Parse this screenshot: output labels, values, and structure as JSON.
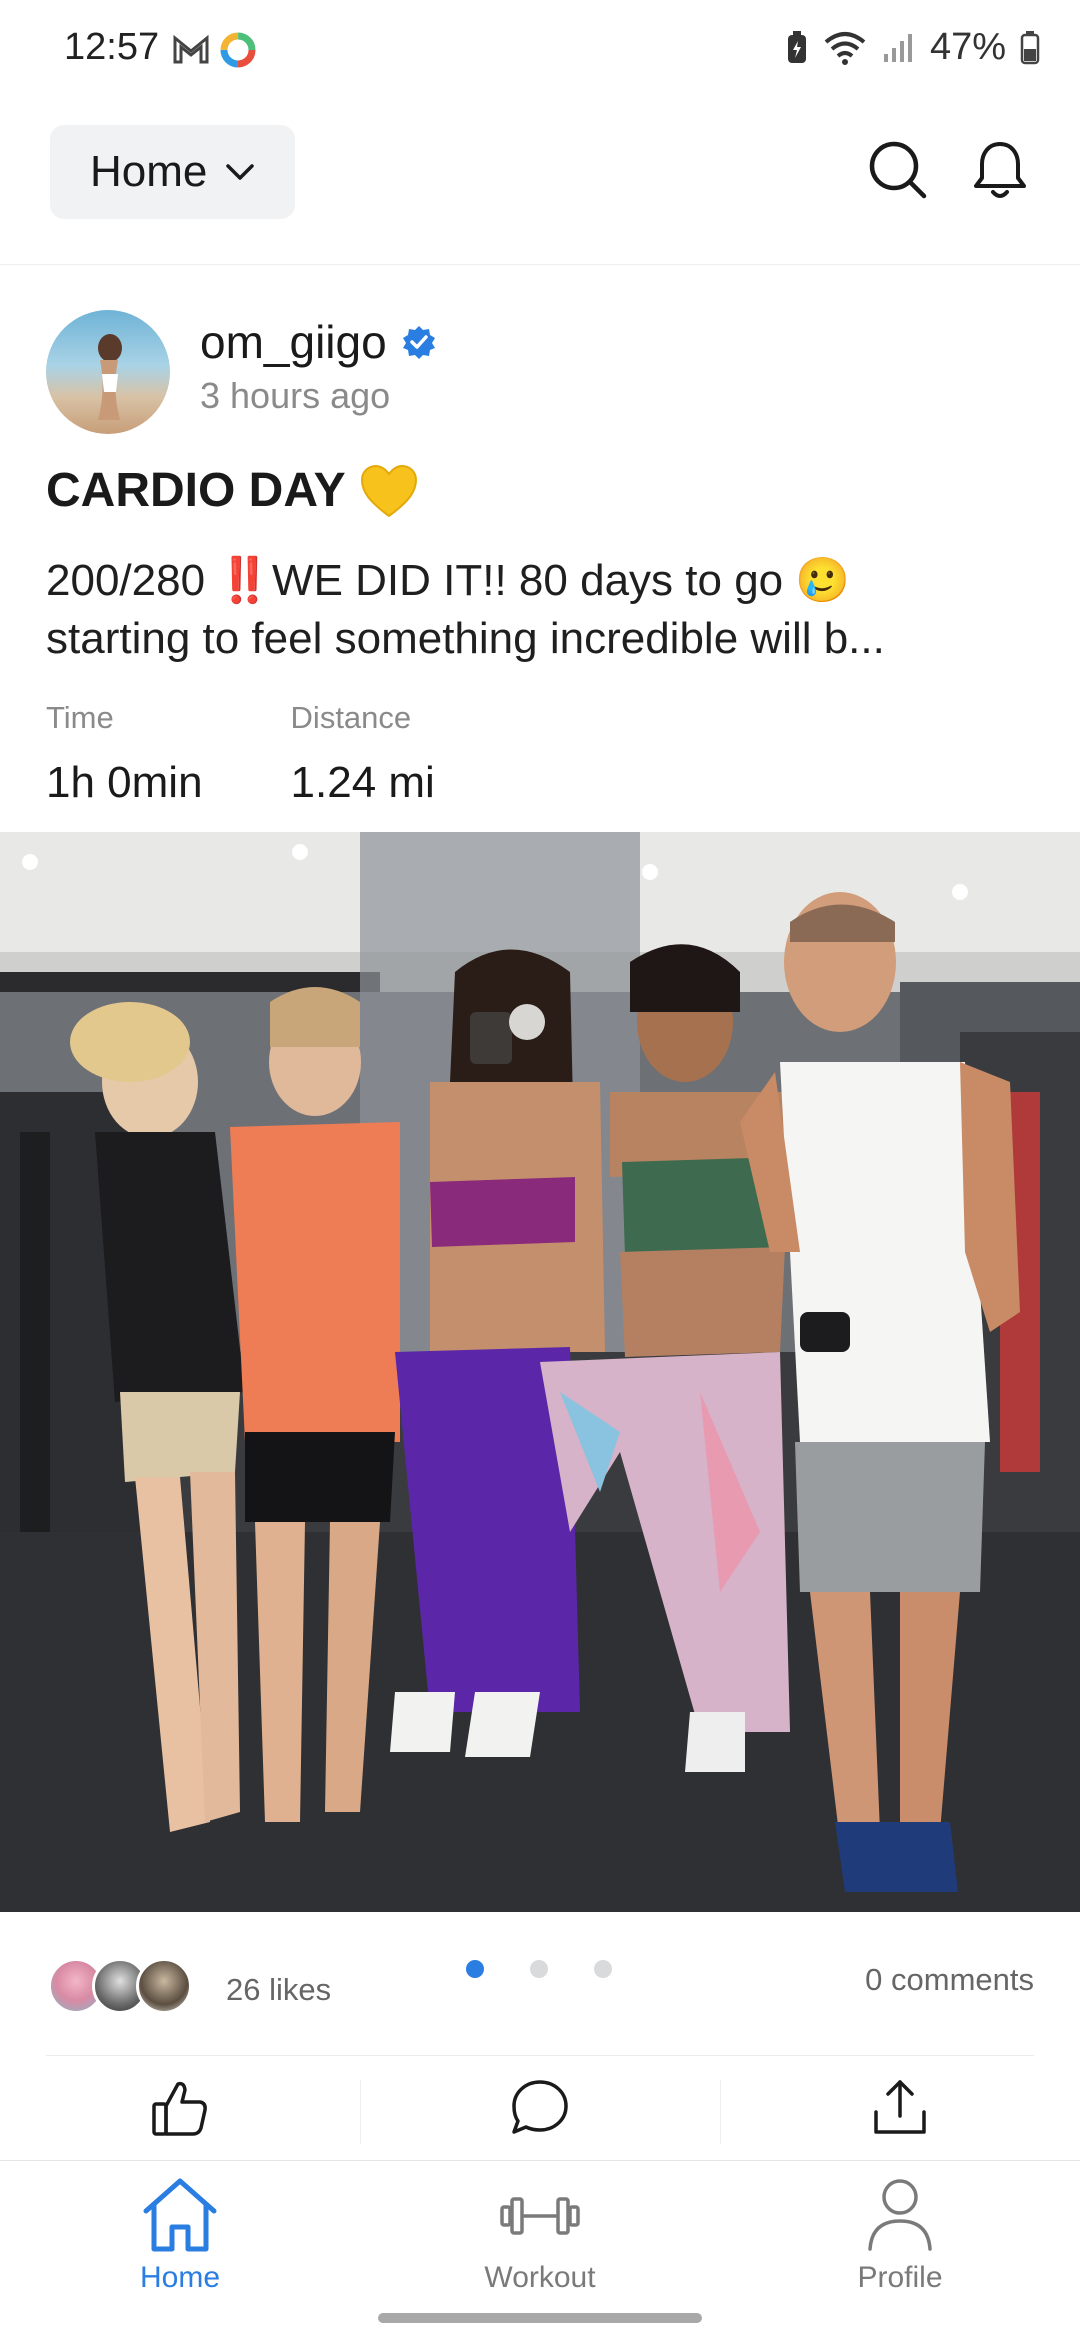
{
  "status_bar": {
    "time": "12:57",
    "battery": "47%"
  },
  "header": {
    "dropdown_label": "Home",
    "icons": [
      "search-icon",
      "bell-icon"
    ]
  },
  "post": {
    "username": "om_giigo",
    "verified": true,
    "time_ago": "3 hours ago",
    "title": "CARDIO DAY",
    "title_emoji": "yellow-heart-icon",
    "description_line1": "200/280 ‼️WE DID IT!! 80 days to go 🥲",
    "description_line2": "starting to feel something incredible will b...",
    "stats": [
      {
        "label": "Time",
        "value": "1h 0min"
      },
      {
        "label": "Distance",
        "value": "1.24 mi"
      }
    ],
    "likes": "26 likes",
    "comments": "0 comments",
    "carousel_pages": 3,
    "carousel_active": 1
  },
  "actions": [
    "like-icon",
    "comment-icon",
    "share-icon"
  ],
  "bottom_nav": [
    {
      "label": "Home",
      "icon": "home-icon",
      "active": true
    },
    {
      "label": "Workout",
      "icon": "dumbbell-icon",
      "active": false
    },
    {
      "label": "Profile",
      "icon": "person-icon",
      "active": false
    }
  ],
  "colors": {
    "accent": "#2a7de1",
    "verified": "#2a7de1",
    "text": "#1a1a1a",
    "muted": "#8a8a8a"
  }
}
